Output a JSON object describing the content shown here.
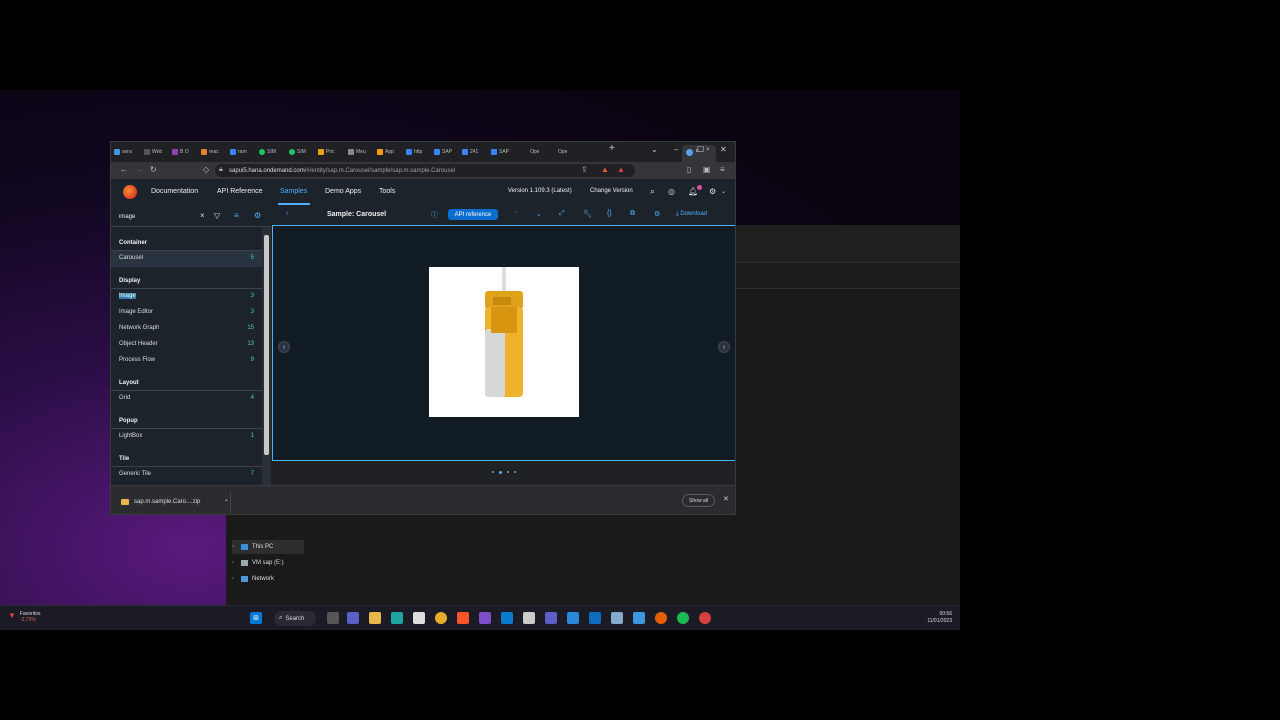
{
  "browser": {
    "tabs": [
      "sera",
      "Web",
      "B O",
      "reac",
      "ram",
      "SIM",
      "SIM",
      "Pric",
      "Meu",
      "App",
      "http",
      "SAP",
      "241",
      "SAP",
      "Ope",
      "Ope"
    ],
    "url_host": "sapui5.hana.ondemand.com",
    "url_path": "/#/entity/sap.m.Carousel/sample/sap.m.sample.Carousel"
  },
  "shell": {
    "nav": [
      "Documentation",
      "API Reference",
      "Samples",
      "Demo Apps",
      "Tools"
    ],
    "version": "Version 1.109.3 (Latest)",
    "change_version": "Change Version"
  },
  "sidebar": {
    "search_value": "image",
    "groups": [
      {
        "title": "Container",
        "items": [
          {
            "label": "Carousel",
            "count": "5"
          }
        ]
      },
      {
        "title": "Display",
        "items": [
          {
            "label": "Image",
            "count": "3"
          },
          {
            "label": "Image Editor",
            "count": "3"
          },
          {
            "label": "Network Graph",
            "count": "15"
          },
          {
            "label": "Object Header",
            "count": "13"
          },
          {
            "label": "Process Flow",
            "count": "9"
          }
        ]
      },
      {
        "title": "Layout",
        "items": [
          {
            "label": "Grid",
            "count": "4"
          }
        ]
      },
      {
        "title": "Popup",
        "items": [
          {
            "label": "LightBox",
            "count": "1"
          }
        ]
      },
      {
        "title": "Tile",
        "items": [
          {
            "label": "Generic Tile",
            "count": "7"
          }
        ]
      }
    ]
  },
  "sample": {
    "title": "Sample: Carousel",
    "api_reference": "API reference",
    "download": "Download"
  },
  "downloads": {
    "file": "sap.m.sample.Caro....zip",
    "show_all": "Show all"
  },
  "explorer": {
    "nav": [
      "This PC",
      "VM sap (E:)",
      "Network"
    ]
  },
  "taskbar": {
    "weather_title": "Favoritos",
    "weather_value": "-2,73%",
    "search": "Search",
    "time": "00:56",
    "date": "11/01/2023"
  },
  "colors": {
    "accent": "#4db1ff",
    "shell_bg": "#1d232a",
    "count": "#4fd1b8"
  }
}
